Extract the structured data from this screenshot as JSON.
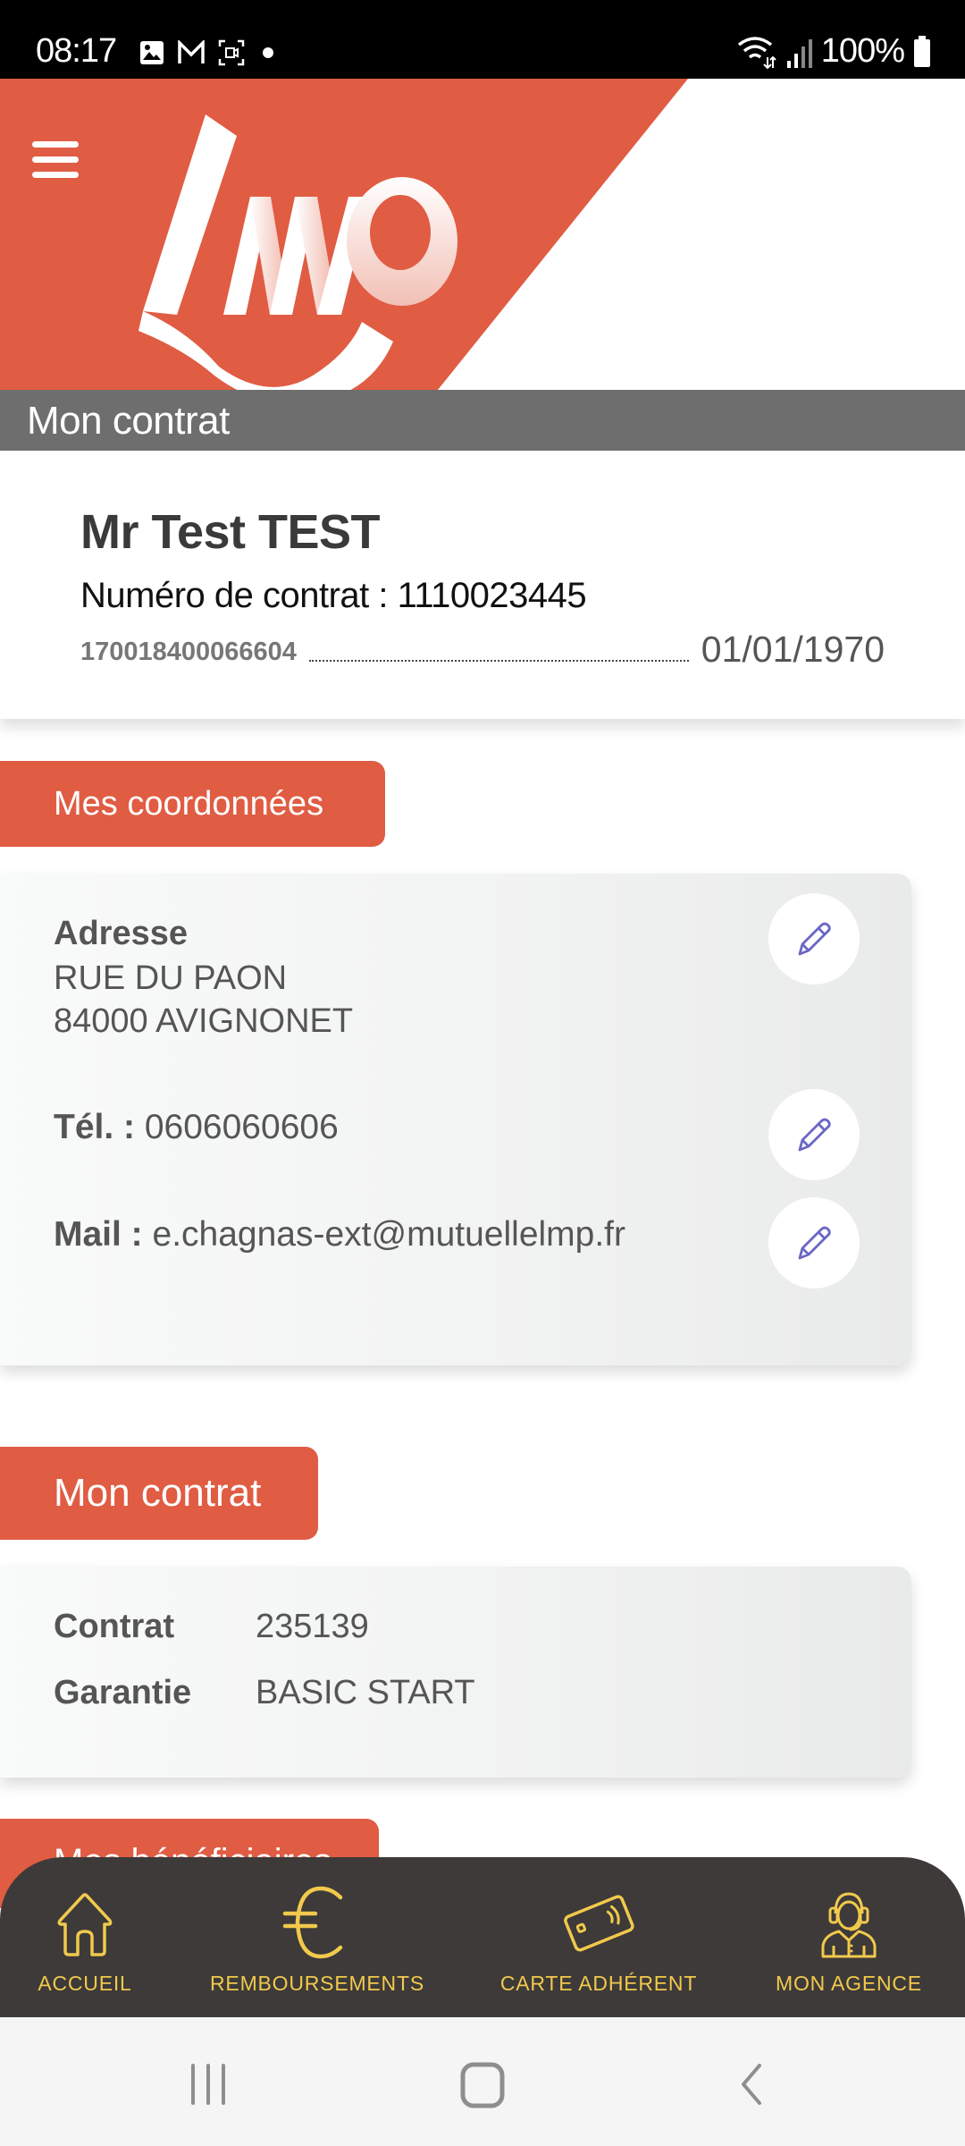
{
  "status_bar": {
    "time": "08:17",
    "left_icons": [
      "gallery-icon",
      "gmail-icon",
      "screen-record-icon",
      "dot-icon"
    ],
    "right_icons": [
      "wifi-icon",
      "signal-icon",
      "battery-icon"
    ],
    "battery": "100%"
  },
  "header": {
    "menu_icon": "hamburger-icon",
    "logo": "lmp-logo",
    "page_title": "Mon contrat",
    "brand_color": "#e05c43"
  },
  "identity": {
    "name": "Mr Test TEST",
    "contract_line": "Numéro de contrat : 1110023445",
    "member_id": "170018400066604",
    "date": "01/01/1970"
  },
  "coordonnees": {
    "tab_label": "Mes coordonnées",
    "address_label": "Adresse",
    "address_line1": "RUE DU PAON",
    "address_line2": "84000 AVIGNONET",
    "tel_label": "Tél. :",
    "tel_value": "0606060606",
    "mail_label": "Mail :",
    "mail_value": "e.chagnas-ext@mutuellelmp.fr",
    "edit_icon": "pencil-icon"
  },
  "contrat": {
    "tab_label": "Mon contrat",
    "rows": [
      {
        "key": "Contrat",
        "value": "235139"
      },
      {
        "key": "Garantie",
        "value": "BASIC START"
      }
    ]
  },
  "beneficiaires": {
    "tab_label": "Mes bénéficiaires"
  },
  "bottom_nav": {
    "accent_color": "#f2c94c",
    "items": [
      {
        "label": "ACCUEIL",
        "icon": "home-icon"
      },
      {
        "label": "REMBOURSEMENTS",
        "icon": "euro-icon"
      },
      {
        "label": "CARTE ADHÉRENT",
        "icon": "card-icon"
      },
      {
        "label": "MON AGENCE",
        "icon": "agent-headset-icon"
      }
    ]
  },
  "system_nav": {
    "buttons": [
      "recents-icon",
      "home-circle-icon",
      "back-icon"
    ]
  }
}
